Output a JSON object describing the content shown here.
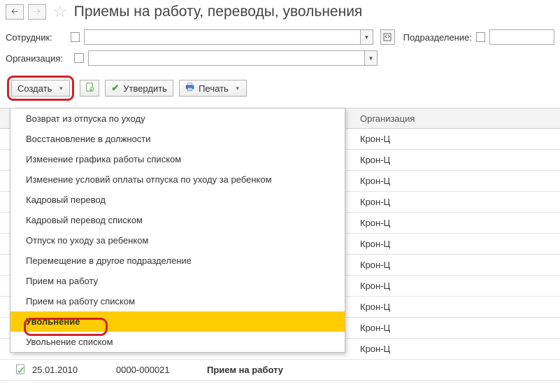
{
  "header": {
    "title": "Приемы на работу, переводы, увольнения"
  },
  "filters": {
    "employee_label": "Сотрудник:",
    "subdivision_label": "Подразделение:",
    "organization_label": "Организация:"
  },
  "toolbar": {
    "create_label": "Создать",
    "approve_label": "Утвердить",
    "print_label": "Печать"
  },
  "dropdown": {
    "items": [
      "Возврат из отпуска по уходу",
      "Восстановление в должности",
      "Изменение графика работы списком",
      "Изменение условий оплаты отпуска по уходу за ребенком",
      "Кадровый перевод",
      "Кадровый перевод списком",
      "Отпуск по уходу за ребенком",
      "Перемещение в другое подразделение",
      "Прием на работу",
      "Прием на работу списком",
      "Увольнение",
      "Увольнение списком"
    ]
  },
  "table": {
    "col_org": "Организация",
    "org_value": "Крон-Ц"
  },
  "bottom_row": {
    "date": "25.01.2010",
    "number": "0000-000021",
    "type": "Прием на работу"
  }
}
